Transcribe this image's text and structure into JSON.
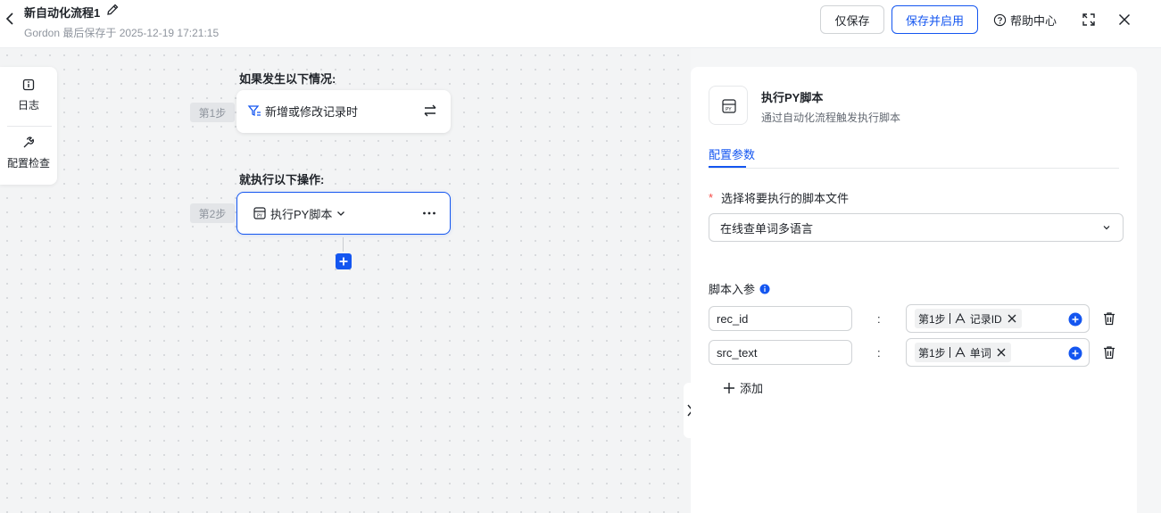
{
  "header": {
    "title": "新自动化流程1",
    "subtitle": "Gordon 最后保存于 2025-12-19 17:21:15",
    "save_label": "仅保存",
    "save_enable_label": "保存并启用",
    "help_label": "帮助中心"
  },
  "toolbar": {
    "log_label": "日志",
    "check_label": "配置检查"
  },
  "flow": {
    "trigger_heading": "如果发生以下情况:",
    "action_heading": "就执行以下操作:",
    "step1_tag": "第1步",
    "step2_tag": "第2步",
    "trigger_label": "新增或修改记录时",
    "action_label": "执行PY脚本"
  },
  "panel": {
    "title": "执行PY脚本",
    "description": "通过自动化流程触发执行脚本",
    "tab_label": "配置参数",
    "script_field_label": "选择将要执行的脚本文件",
    "script_selected": "在线查单词多语言",
    "params_label": "脚本入参",
    "params": [
      {
        "name": "rec_id",
        "step": "第1步",
        "field": "记录ID"
      },
      {
        "name": "src_text",
        "step": "第1步",
        "field": "单词"
      }
    ],
    "colon": ":",
    "add_label": "添加"
  },
  "colors": {
    "accent": "#1456f0",
    "required": "#f54a45",
    "canvas_bg": "#f3f4f5"
  }
}
